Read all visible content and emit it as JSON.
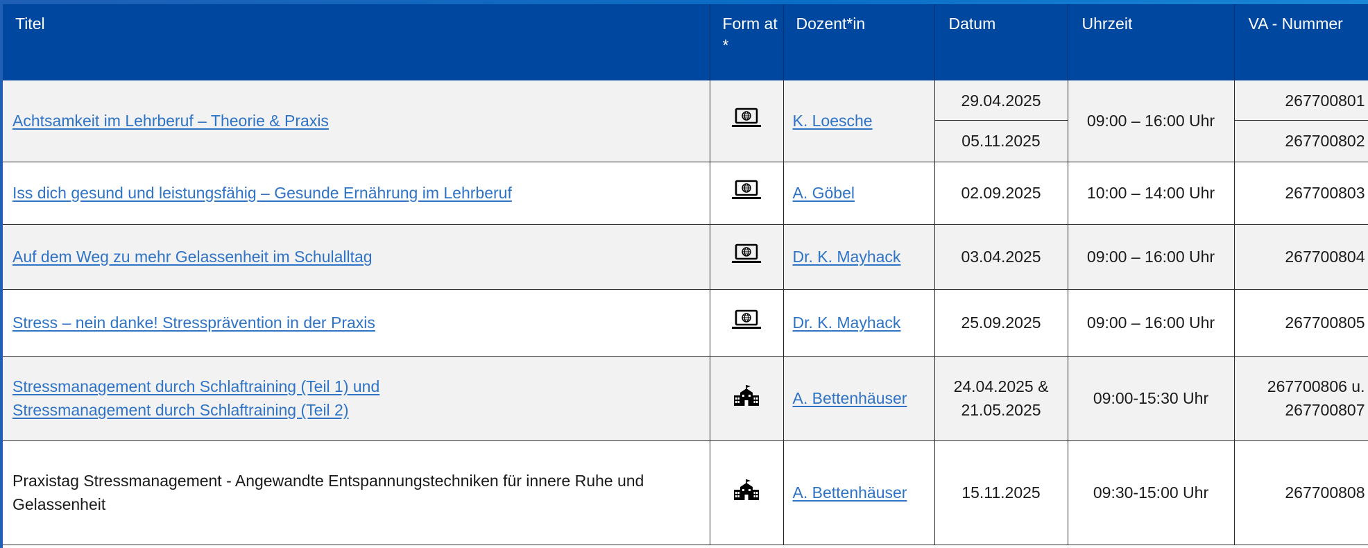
{
  "table": {
    "headers": {
      "title": "Titel",
      "format": "Form at *",
      "lecturer": "Dozent*in",
      "date": "Datum",
      "time": "Uhrzeit",
      "va": "VA - Nummer"
    },
    "rows": [
      {
        "title": "Achtsamkeit im Lehrberuf – Theorie & Praxis",
        "format_icon": "laptop-globe-icon",
        "lecturer": "K. Loesche",
        "date_1": "29.04.2025",
        "date_2": "05.11.2025",
        "time": "09:00 – 16:00 Uhr",
        "va_1": "267700801",
        "va_2": "267700802"
      },
      {
        "title": "Iss dich gesund und leistungsfähig – Gesunde Ernährung im Lehrberuf",
        "format_icon": "laptop-globe-icon",
        "lecturer": "A. Göbel",
        "date": "02.09.2025",
        "time": "10:00 – 14:00 Uhr",
        "va": "267700803"
      },
      {
        "title": "Auf dem Weg zu mehr Gelassenheit im Schulalltag",
        "format_icon": "laptop-globe-icon",
        "lecturer": "Dr. K. Mayhack",
        "date": "03.04.2025",
        "time": "09:00 – 16:00 Uhr",
        "va": "267700804"
      },
      {
        "title": "Stress – nein danke! Stressprävention in der Praxis",
        "format_icon": "laptop-globe-icon",
        "lecturer": "Dr. K. Mayhack",
        "date": "25.09.2025",
        "time": "09:00 – 16:00 Uhr",
        "va": "267700805"
      },
      {
        "title_line1": "Stressmanagement durch Schlaftraining (Teil 1) und",
        "title_line2": "Stressmanagement durch Schlaftraining (Teil 2)",
        "format_icon": "school-building-icon",
        "lecturer": "A. Bettenhäuser",
        "date_line1": "24.04.2025 &",
        "date_line2": "21.05.2025",
        "time": "09:00-15:30 Uhr",
        "va_line1": "267700806 u.",
        "va_line2": "267700807"
      },
      {
        "title": "Praxistag Stressmanagement - Angewandte Entspannungstechniken für innere Ruhe und Gelassenheit",
        "format_icon": "school-building-icon",
        "lecturer": "A. Bettenhäuser",
        "date": "15.11.2025",
        "time": "09:30-15:00 Uhr",
        "va": "267700808"
      }
    ]
  }
}
